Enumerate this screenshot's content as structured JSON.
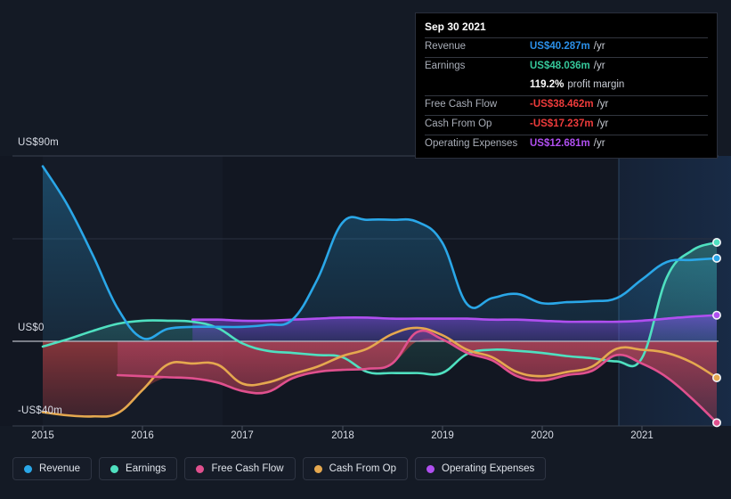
{
  "colors": {
    "revenue": "#2aa7e8",
    "earnings": "#4fe0c0",
    "free_cash_flow": "#e0508e",
    "cash_from_op": "#e8a council",
    "cash_from_op_fix": "#e5a84f",
    "operating_expenses": "#b04ff0",
    "background": "#141a25",
    "tooltip_bg": "#000000",
    "negative_fill": "#7e3036",
    "gridline": "#343a47"
  },
  "yaxis": {
    "top_label": "US$90m",
    "zero_label": "US$0",
    "bottom_label": "-US$40m",
    "top_value": 90,
    "zero_value": 0,
    "bottom_value": -40
  },
  "xaxis": {
    "ticks": [
      "2015",
      "2016",
      "2017",
      "2018",
      "2019",
      "2020",
      "2021"
    ]
  },
  "tooltip": {
    "date": "Sep 30 2021",
    "rows": [
      {
        "label": "Revenue",
        "value": "US$40.287m",
        "unit": "/yr",
        "color": "#2b8fe8"
      },
      {
        "label": "Earnings",
        "value": "US$48.036m",
        "unit": "/yr",
        "color": "#35c79a"
      },
      {
        "label": "",
        "value": "119.2%",
        "unit": "profit margin",
        "color": "#ffffff"
      },
      {
        "label": "Free Cash Flow",
        "value": "-US$38.462m",
        "unit": "/yr",
        "color": "#ee3b3b"
      },
      {
        "label": "Cash From Op",
        "value": "-US$17.237m",
        "unit": "/yr",
        "color": "#ee3b3b"
      },
      {
        "label": "Operating Expenses",
        "value": "US$12.681m",
        "unit": "/yr",
        "color": "#b04ff0"
      }
    ]
  },
  "legend": {
    "items": [
      {
        "label": "Revenue",
        "color": "#2aa7e8"
      },
      {
        "label": "Earnings",
        "color": "#4fe0c0"
      },
      {
        "label": "Free Cash Flow",
        "color": "#e0508e"
      },
      {
        "label": "Cash From Op",
        "color": "#e5a84f"
      },
      {
        "label": "Operating Expenses",
        "color": "#b04ff0"
      }
    ]
  },
  "chart_data": {
    "type": "area",
    "title": "",
    "xlabel": "",
    "ylabel": "US$m",
    "ylim": [
      -40,
      90
    ],
    "grid": true,
    "legend_position": "bottom",
    "x": [
      2015.0,
      2015.25,
      2015.5,
      2015.75,
      2016.0,
      2016.25,
      2016.5,
      2016.75,
      2017.0,
      2017.25,
      2017.5,
      2017.75,
      2018.0,
      2018.25,
      2018.5,
      2018.75,
      2019.0,
      2019.25,
      2019.5,
      2019.75,
      2020.0,
      2020.25,
      2020.5,
      2020.75,
      2021.0,
      2021.25,
      2021.5,
      2021.75
    ],
    "series": [
      {
        "name": "Revenue",
        "color": "#2aa7e8",
        "values": [
          85.0,
          66.0,
          42.0,
          16.0,
          1.5,
          6.0,
          7.0,
          7.0,
          7.0,
          8.0,
          10.5,
          30.0,
          57.5,
          59.0,
          59.0,
          58.0,
          48.0,
          18.0,
          21.0,
          23.0,
          18.5,
          19.0,
          19.5,
          21.0,
          30.0,
          38.5,
          39.5,
          40.287
        ]
      },
      {
        "name": "Earnings",
        "color": "#4fe0c0",
        "values": [
          -2.5,
          1.0,
          5.0,
          8.5,
          10.0,
          10.0,
          9.5,
          6.5,
          -1.0,
          -4.5,
          -5.5,
          -6.5,
          -7.5,
          -14.5,
          -15.0,
          -15.0,
          -15.0,
          -6.0,
          -4.0,
          -4.5,
          -5.5,
          -7.0,
          -8.0,
          -9.5,
          -8.0,
          31.0,
          44.0,
          48.036
        ]
      },
      {
        "name": "Free Cash Flow",
        "color": "#e0508e",
        "values": [
          null,
          null,
          null,
          -16.0,
          -16.5,
          -17.0,
          -17.5,
          -19.5,
          -23.5,
          -24.0,
          -17.5,
          -14.5,
          -13.5,
          -13.0,
          -10.5,
          4.5,
          1.0,
          -5.5,
          -9.0,
          -16.5,
          -18.5,
          -16.0,
          -14.0,
          -6.5,
          -10.5,
          -17.0,
          -27.0,
          -38.462
        ]
      },
      {
        "name": "Cash From Op",
        "color": "#e5a84f",
        "values": [
          -33.5,
          -35.0,
          -35.5,
          -34.0,
          -23.0,
          -11.0,
          -10.5,
          -11.0,
          -20.0,
          -19.5,
          -15.5,
          -12.0,
          -7.0,
          -3.5,
          3.5,
          6.5,
          3.0,
          -4.0,
          -7.5,
          -14.5,
          -16.5,
          -14.5,
          -12.0,
          -3.5,
          -4.0,
          -5.5,
          -10.0,
          -17.237
        ]
      },
      {
        "name": "Operating Expenses",
        "color": "#b04ff0",
        "values": [
          null,
          null,
          null,
          null,
          null,
          null,
          10.5,
          10.5,
          10.0,
          10.0,
          10.5,
          11.0,
          11.5,
          11.5,
          11.0,
          11.0,
          11.0,
          11.0,
          10.5,
          10.5,
          10.0,
          9.5,
          9.5,
          9.5,
          10.0,
          11.0,
          12.0,
          12.681
        ]
      }
    ]
  }
}
